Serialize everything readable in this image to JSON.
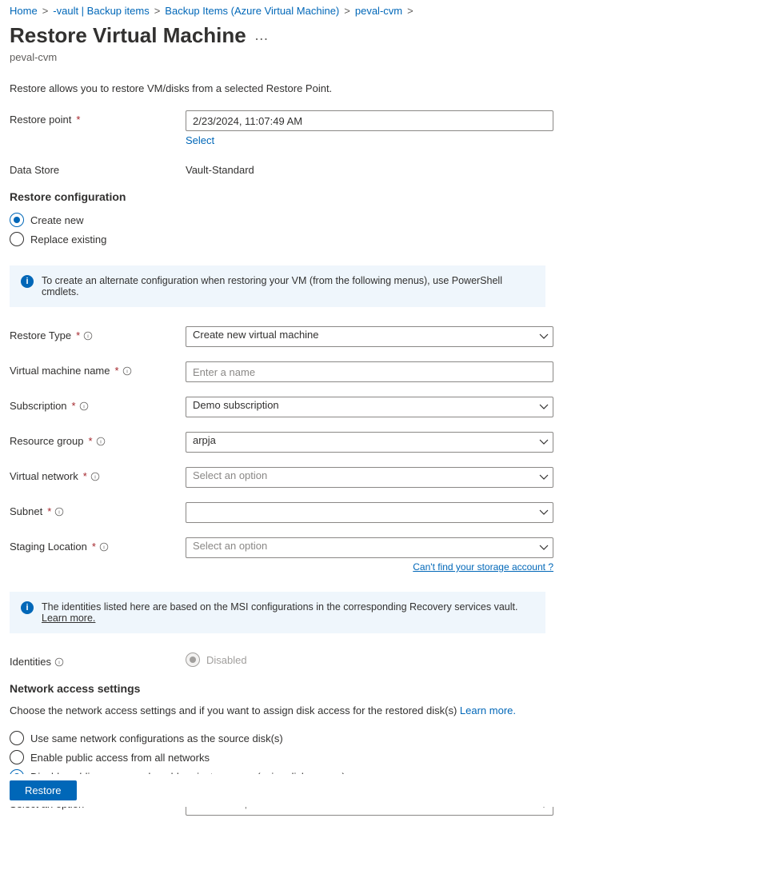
{
  "breadcrumb": {
    "items": [
      "Home",
      "-vault | Backup items",
      "Backup Items (Azure Virtual Machine)",
      "peval-cvm"
    ]
  },
  "title": "Restore Virtual Machine",
  "subtitle": "peval-cvm",
  "description": "Restore allows you to restore VM/disks from a selected Restore Point.",
  "restore_point": {
    "label": "Restore point",
    "value": "2/23/2024, 11:07:49 AM",
    "select_link": "Select"
  },
  "data_store": {
    "label": "Data Store",
    "value": "Vault-Standard"
  },
  "config_section": {
    "heading": "Restore configuration",
    "create_new": "Create new",
    "replace_existing": "Replace existing"
  },
  "info_box_1": "To create an alternate configuration when restoring your VM (from the following menus), use PowerShell cmdlets.",
  "fields": {
    "restore_type": {
      "label": "Restore Type",
      "value": "Create new virtual machine"
    },
    "vm_name": {
      "label": "Virtual machine name",
      "placeholder": "Enter a name"
    },
    "subscription": {
      "label": "Subscription",
      "value": "Demo subscription"
    },
    "resource_group": {
      "label": "Resource group",
      "value": "arpja"
    },
    "vnet": {
      "label": "Virtual network",
      "placeholder": "Select an option"
    },
    "subnet": {
      "label": "Subnet",
      "value": ""
    },
    "staging_location": {
      "label": "Staging Location",
      "placeholder": "Select an option"
    },
    "storage_link": "Can't find your storage account ?"
  },
  "info_box_2": {
    "text": "The identities listed here are based on the MSI configurations in the corresponding Recovery services vault.",
    "learn_more": "Learn more."
  },
  "identities": {
    "label": "Identities",
    "option": "Disabled"
  },
  "network_section": {
    "heading": "Network access settings",
    "desc": "Choose the network access settings and if you want to assign disk access for the restored disk(s)",
    "learn_more": "Learn more.",
    "opt_same": "Use same network configurations as the source disk(s)",
    "opt_public": "Enable public access from all networks",
    "opt_private": "Disable public access and enable private access (using disk access)",
    "select_label": "Select an option",
    "select_placeholder": "Select an option"
  },
  "footer": {
    "restore": "Restore"
  }
}
